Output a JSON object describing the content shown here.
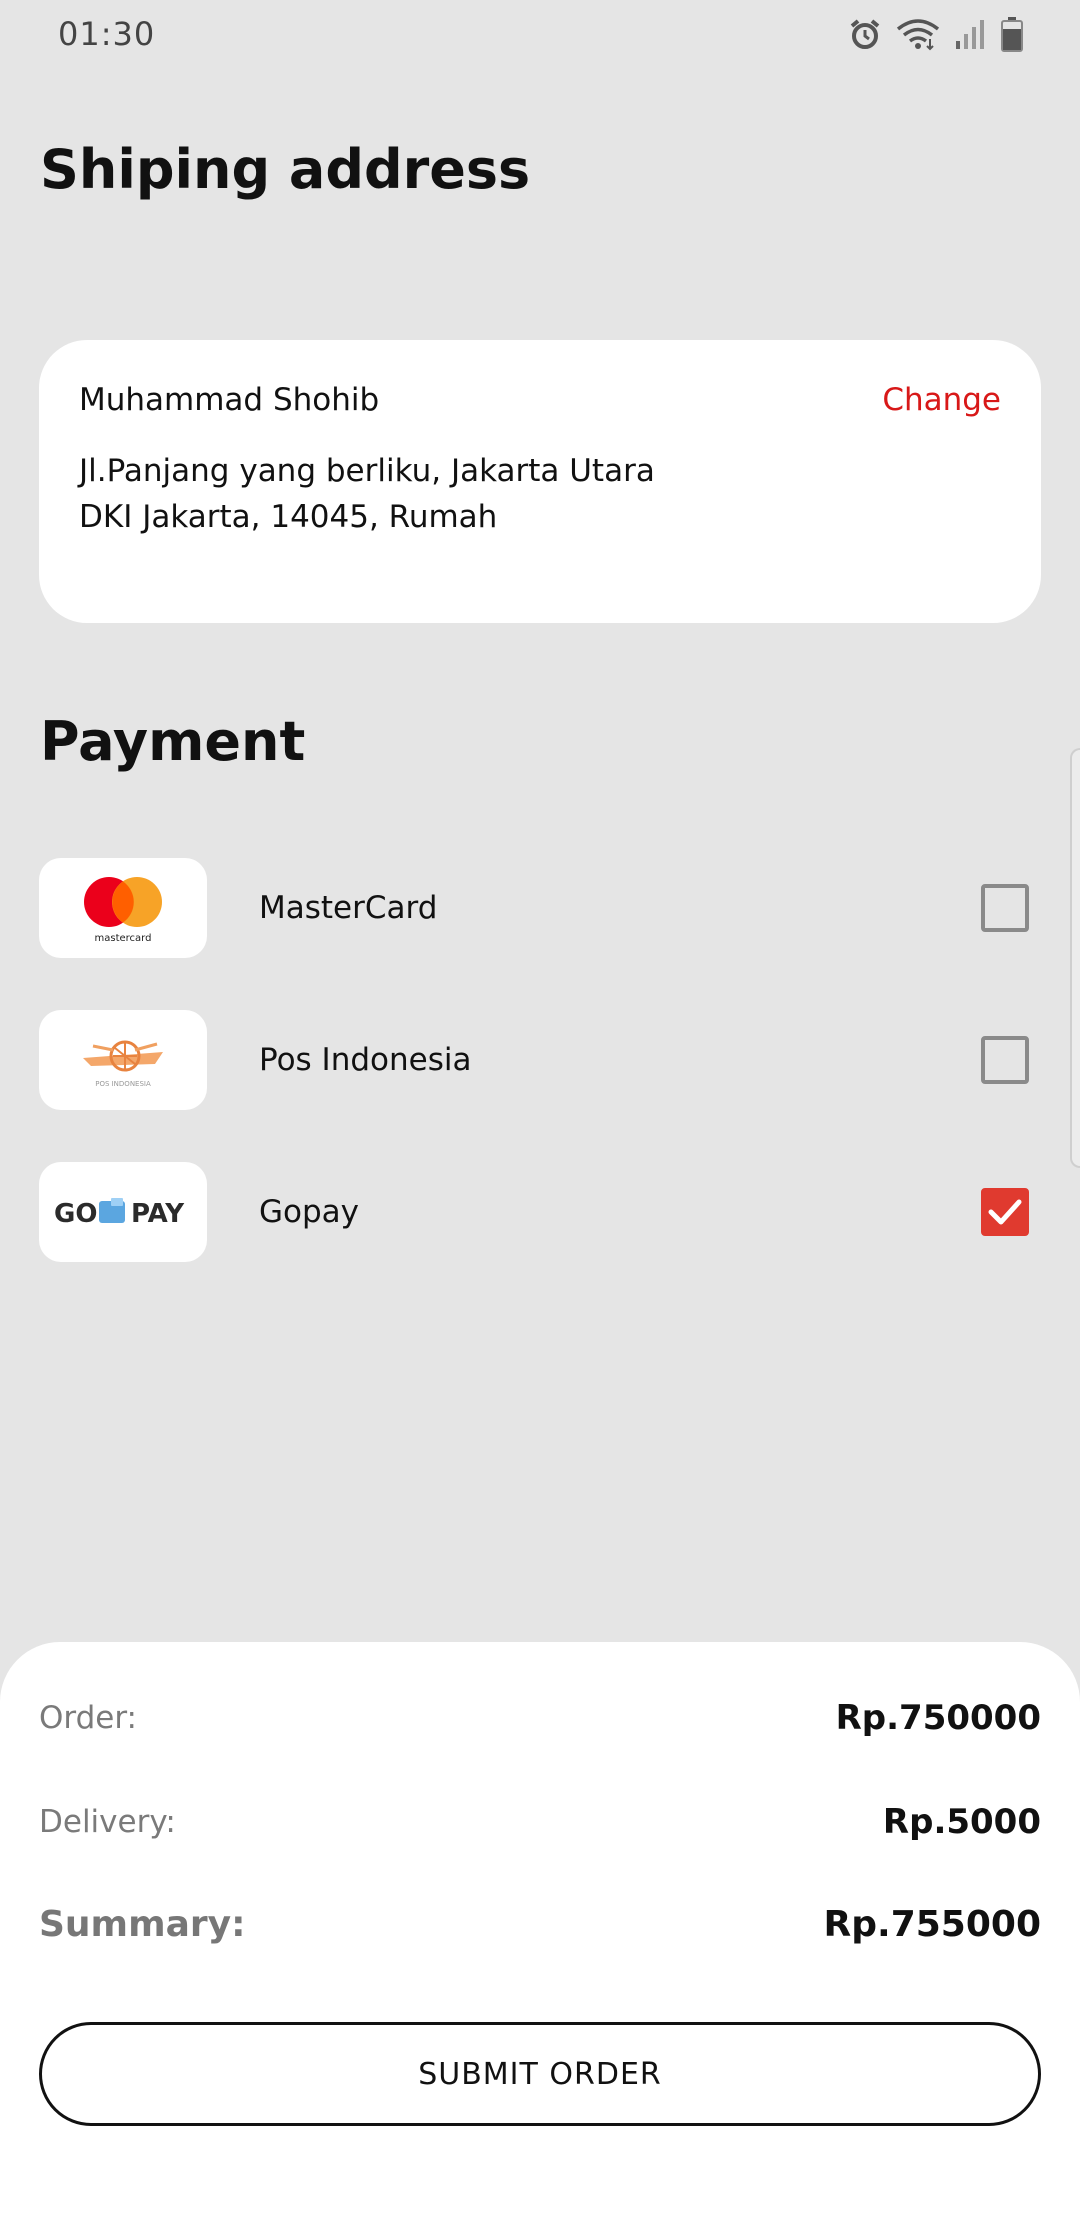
{
  "status_bar": {
    "time": "01:30",
    "icons": [
      "alarm-icon",
      "wifi-icon",
      "signal-icon",
      "battery-icon"
    ]
  },
  "shipping": {
    "title": "Shiping address",
    "name": "Muhammad Shohib",
    "change_label": "Change",
    "address_line1": "Jl.Panjang yang berliku, Jakarta Utara",
    "address_line2": "DKI Jakarta, 14045, Rumah"
  },
  "payment": {
    "title": "Payment",
    "methods": [
      {
        "label": "MasterCard",
        "logo_text": "mastercard",
        "checked": false
      },
      {
        "label": "Pos Indonesia",
        "logo_text": "POS INDONESIA",
        "checked": false
      },
      {
        "label": "Gopay",
        "logo_text_left": "GO",
        "logo_text_right": "PAY",
        "checked": true
      }
    ]
  },
  "summary": {
    "order_label": "Order:",
    "order_value": "Rp.750000",
    "delivery_label": "Delivery:",
    "delivery_value": "Rp.5000",
    "total_label": "Summary:",
    "total_value": "Rp.755000",
    "submit_label": "SUBMIT ORDER"
  },
  "colors": {
    "background": "#e5e5e5",
    "card": "#ffffff",
    "accent_red": "#d81818",
    "checkbox_checked": "#e03a2f"
  }
}
